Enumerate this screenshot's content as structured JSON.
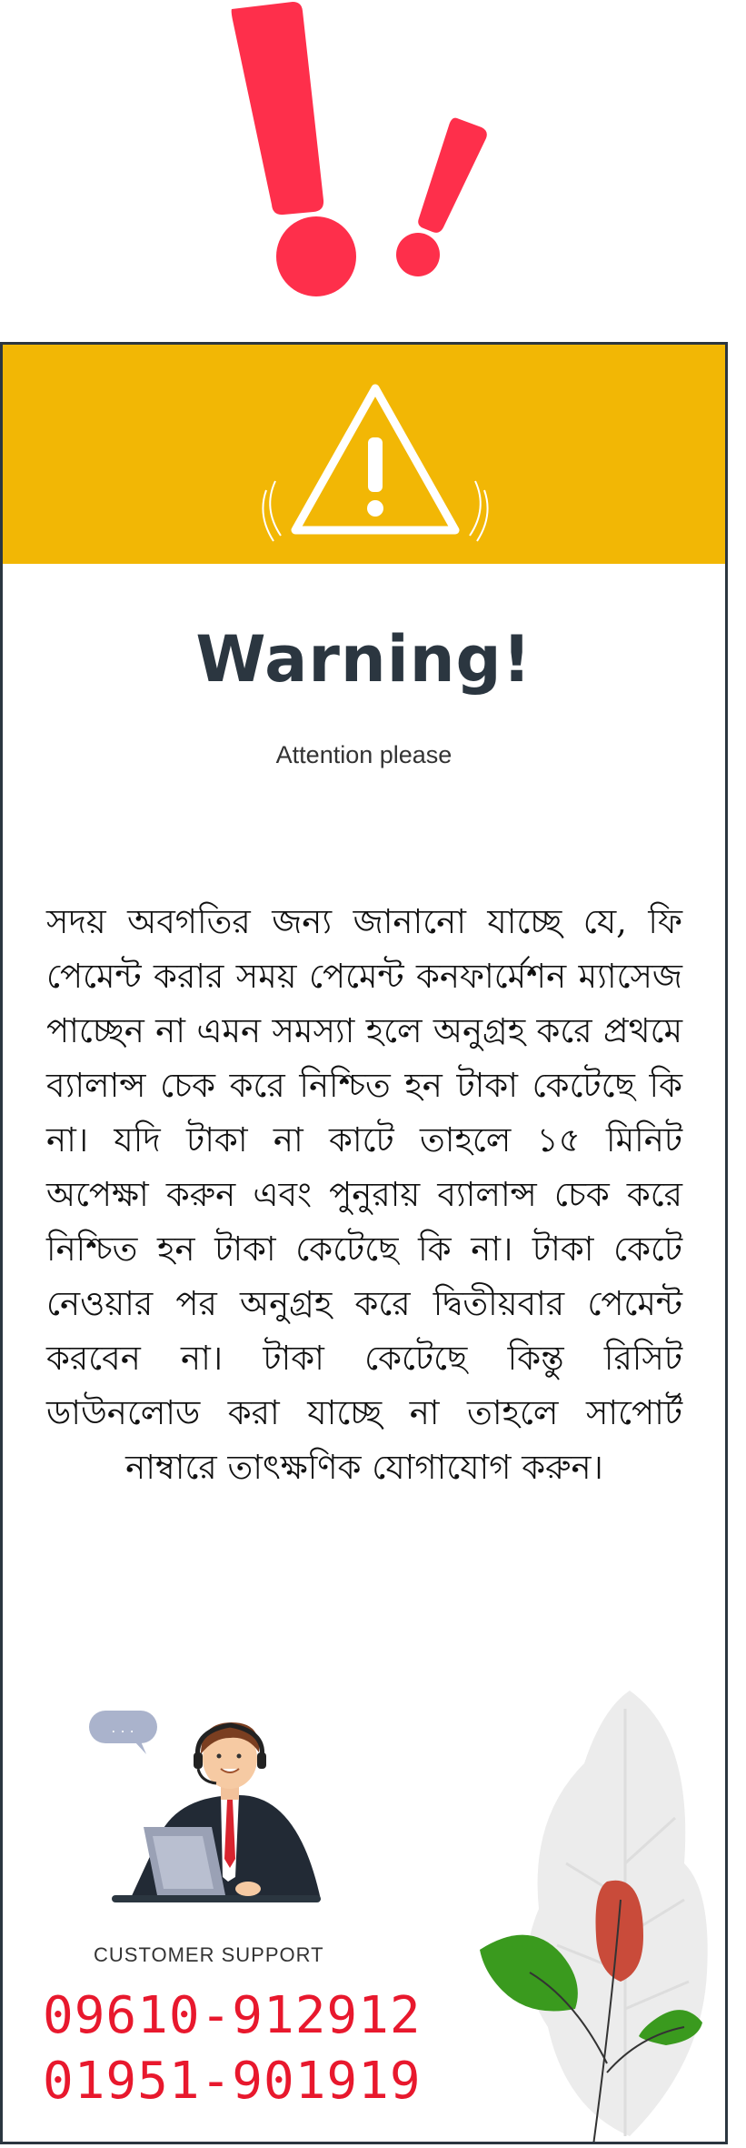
{
  "warning": {
    "title": "Warning!",
    "subtitle": "Attention please"
  },
  "notice": {
    "text": "সদয় অবগতির জন্য জানানো যাচ্ছে যে, ফি পেমেন্ট করার সময় পেমেন্ট কনফার্মেশন ম্যাসেজ পাচ্ছেন না এমন সমস্যা হলে অনুগ্রহ করে প্রথমে ব্যালান্স চেক করে নিশ্চিত হন টাকা কেটেছে কি না। যদি টাকা না কাটে তাহলে ১৫ মিনিট অপেক্ষা করুন এবং পুনুরায় ব্যালান্স চেক করে নিশ্চিত হন টাকা কেটেছে কি না। টাকা কেটে নেওয়ার পর অনুগ্রহ করে দ্বিতীয়বার পেমেন্ট করবেন না। টাকা কেটেছে কিন্তু রিসিট ডাউনলোড করা যাচ্ছে না তাহলে সাপোর্ট নাম্বারে তাৎক্ষণিক যোগাযোগ করুন।"
  },
  "support": {
    "label": "CUSTOMER SUPPORT",
    "phones": [
      "09610-912912",
      "01951-901919"
    ],
    "bubble_text": ". . ."
  },
  "colors": {
    "accent_red": "#fe2f4b",
    "banner_yellow": "#f2b705",
    "border_dark": "#2b3640",
    "phone_red": "#e8182d"
  },
  "icons": {
    "top": "exclamation-marks-icon",
    "banner": "warning-triangle-icon"
  }
}
